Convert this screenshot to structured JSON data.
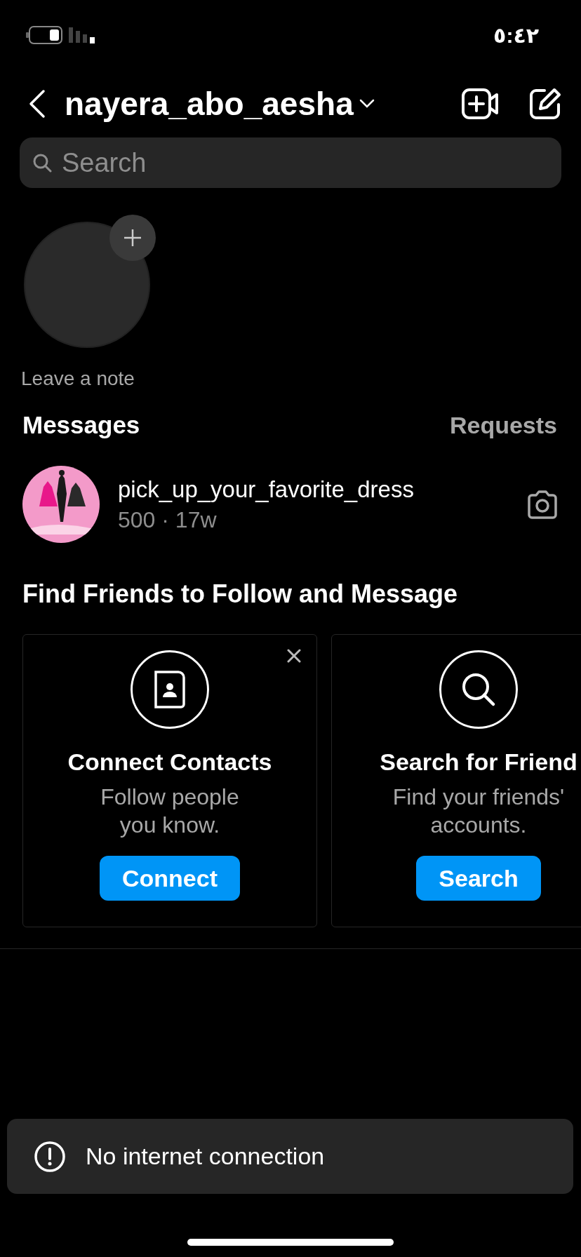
{
  "status_bar": {
    "time": "٥:٤٢"
  },
  "header": {
    "title": "nayera_abo_aesha"
  },
  "search": {
    "placeholder": "Search"
  },
  "note": {
    "label": "Leave a note"
  },
  "messages": {
    "title": "Messages",
    "requests": "Requests"
  },
  "threads": [
    {
      "name": "pick_up_your_favorite_dress",
      "subtitle": "500 · 17w"
    }
  ],
  "find_friends": {
    "title": "Find Friends to Follow and Message",
    "cards": [
      {
        "kind": "contacts",
        "title": "Connect Contacts",
        "description": "Follow people you know.",
        "button": "Connect",
        "dismissible": true
      },
      {
        "kind": "search",
        "title": "Search for Friend",
        "description": "Find your friends' accounts.",
        "button": "Search"
      }
    ]
  },
  "toast": {
    "message": "No internet connection"
  }
}
